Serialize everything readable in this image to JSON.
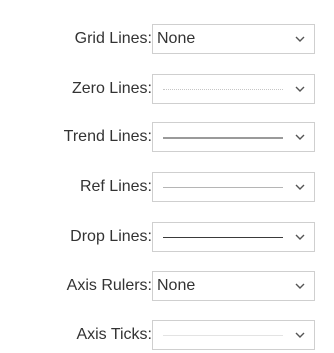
{
  "panel": {
    "rows": [
      {
        "label": "Grid Lines:",
        "value": "None",
        "icon": "chevron-down-icon"
      },
      {
        "label": "Zero Lines:",
        "line_style": "dotted",
        "icon": "chevron-down-icon"
      },
      {
        "label": "Trend Lines:",
        "line_style": "solid-thick",
        "icon": "chevron-down-icon"
      },
      {
        "label": "Ref Lines:",
        "line_style": "solid-thin",
        "icon": "chevron-down-icon"
      },
      {
        "label": "Drop Lines:",
        "line_style": "solid-dark",
        "icon": "chevron-down-icon"
      },
      {
        "label": "Axis Rulers:",
        "value": "None",
        "icon": "chevron-down-icon"
      },
      {
        "label": "Axis Ticks:",
        "line_style": "solid-faint",
        "icon": "chevron-down-icon"
      }
    ]
  },
  "colors": {
    "text": "#333333",
    "border": "#cfcfcf",
    "chevron": "#555555"
  }
}
